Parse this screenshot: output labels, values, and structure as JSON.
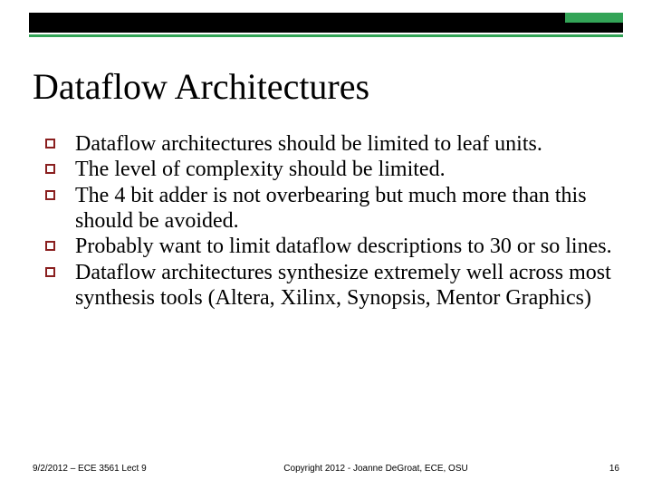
{
  "decor": {
    "accent": "#33a457",
    "bar": "#000000",
    "bullet_border": "#8a1f1f"
  },
  "title": "Dataflow Architectures",
  "bullets": [
    "Dataflow architectures should be limited to leaf units.",
    "The level of complexity should be limited.",
    "The 4 bit adder is not overbearing but much more than this should be avoided.",
    "Probably want to limit dataflow descriptions to 30 or so lines.",
    "Dataflow architectures synthesize extremely well across most synthesis tools (Altera, Xilinx, Synopsis, Mentor Graphics)"
  ],
  "footer": {
    "left": "9/2/2012 – ECE 3561 Lect 9",
    "center": "Copyright 2012 - Joanne DeGroat, ECE, OSU",
    "right": "16"
  }
}
